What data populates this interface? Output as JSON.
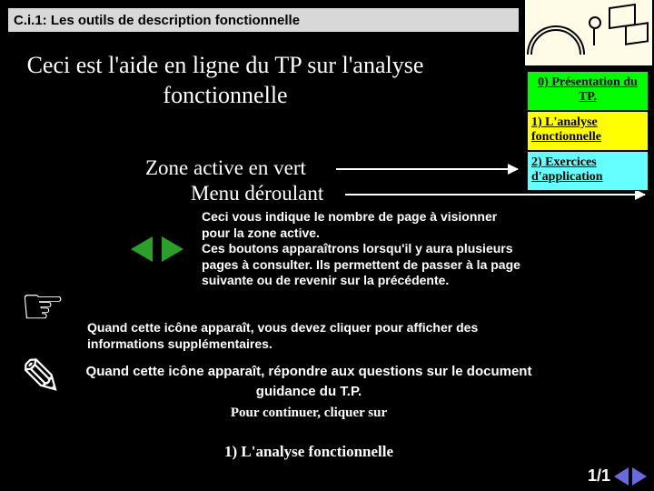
{
  "header": {
    "title": "C.i.1: Les outils de description fonctionnelle"
  },
  "intro": "Ceci est l'aide en ligne du TP sur l'analyse fonctionnelle",
  "pointers": {
    "active_zone": "Zone active en vert",
    "dropdown": "Menu déroulant"
  },
  "sidebar": {
    "items": [
      {
        "label": "0) Présentation du TP."
      },
      {
        "label": "1) L'analyse fonctionnelle"
      },
      {
        "label": "2) Exercices d'application"
      }
    ]
  },
  "info": {
    "pages_hint": "Ceci vous indique le nombre de page à visionner pour la zone active.",
    "buttons_hint": "Ces boutons apparaîtrons lorsqu'il y aura plusieurs pages à consulter. Ils permettent de passer à la page suivante ou de revenir sur la précédente.",
    "hand_hint": "Quand cette icône apparaît, vous devez cliquer pour afficher des informations supplémentaires.",
    "pencil_hint": "Quand cette icône apparaît, répondre aux questions sur le document guidance du T.P.",
    "continue_hint": "Pour continuer, cliquer sur",
    "continue_target": "1) L'analyse fonctionnelle"
  },
  "pager": {
    "text": "1/1"
  }
}
